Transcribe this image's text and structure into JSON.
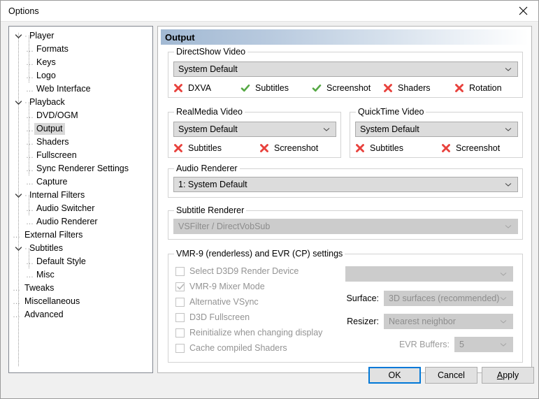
{
  "window": {
    "title": "Options",
    "close_icon": "close-icon"
  },
  "tree": {
    "items": [
      {
        "label": "Player",
        "level": 0,
        "expander": "chevron-down-icon",
        "selected": false
      },
      {
        "label": "Formats",
        "level": 1,
        "expander": "dash",
        "selected": false
      },
      {
        "label": "Keys",
        "level": 1,
        "expander": "dash",
        "selected": false
      },
      {
        "label": "Logo",
        "level": 1,
        "expander": "dash",
        "selected": false
      },
      {
        "label": "Web Interface",
        "level": 1,
        "expander": "dash",
        "selected": false
      },
      {
        "label": "Playback",
        "level": 0,
        "expander": "chevron-down-icon",
        "selected": false
      },
      {
        "label": "DVD/OGM",
        "level": 1,
        "expander": "dash",
        "selected": false
      },
      {
        "label": "Output",
        "level": 1,
        "expander": "dash",
        "selected": true
      },
      {
        "label": "Shaders",
        "level": 1,
        "expander": "dash",
        "selected": false
      },
      {
        "label": "Fullscreen",
        "level": 1,
        "expander": "dash",
        "selected": false
      },
      {
        "label": "Sync Renderer Settings",
        "level": 1,
        "expander": "dash",
        "selected": false
      },
      {
        "label": "Capture",
        "level": 1,
        "expander": "dash",
        "selected": false
      },
      {
        "label": "Internal Filters",
        "level": 0,
        "expander": "chevron-down-icon",
        "selected": false
      },
      {
        "label": "Audio Switcher",
        "level": 1,
        "expander": "dash",
        "selected": false
      },
      {
        "label": "Audio Renderer",
        "level": 1,
        "expander": "dash",
        "selected": false
      },
      {
        "label": "External Filters",
        "level": 0,
        "expander": "dash",
        "selected": false
      },
      {
        "label": "Subtitles",
        "level": 0,
        "expander": "chevron-down-icon",
        "selected": false
      },
      {
        "label": "Default Style",
        "level": 1,
        "expander": "dash",
        "selected": false
      },
      {
        "label": "Misc",
        "level": 1,
        "expander": "dash",
        "selected": false
      },
      {
        "label": "Tweaks",
        "level": 0,
        "expander": "dash",
        "selected": false
      },
      {
        "label": "Miscellaneous",
        "level": 0,
        "expander": "dash",
        "selected": false
      },
      {
        "label": "Advanced",
        "level": 0,
        "expander": "dash",
        "selected": false
      }
    ]
  },
  "page": {
    "header": "Output"
  },
  "directshow": {
    "group_title": "DirectShow Video",
    "combo_value": "System Default",
    "features": [
      {
        "label": "DXVA",
        "state": "no",
        "icon": "red-x-icon"
      },
      {
        "label": "Subtitles",
        "state": "yes",
        "icon": "green-check-icon"
      },
      {
        "label": "Screenshot",
        "state": "yes",
        "icon": "green-check-icon"
      },
      {
        "label": "Shaders",
        "state": "no",
        "icon": "red-x-icon"
      },
      {
        "label": "Rotation",
        "state": "no",
        "icon": "red-x-icon"
      }
    ]
  },
  "realmedia": {
    "group_title": "RealMedia Video",
    "combo_value": "System Default",
    "features": [
      {
        "label": "Subtitles",
        "state": "no",
        "icon": "red-x-icon"
      },
      {
        "label": "Screenshot",
        "state": "no",
        "icon": "red-x-icon"
      }
    ]
  },
  "quicktime": {
    "group_title": "QuickTime Video",
    "combo_value": "System Default",
    "features": [
      {
        "label": "Subtitles",
        "state": "no",
        "icon": "red-x-icon"
      },
      {
        "label": "Screenshot",
        "state": "no",
        "icon": "red-x-icon"
      }
    ]
  },
  "audio_renderer": {
    "group_title": "Audio Renderer",
    "combo_value": "1: System Default"
  },
  "subtitle_renderer": {
    "group_title": "Subtitle Renderer",
    "combo_value": "VSFilter / DirectVobSub",
    "disabled": true
  },
  "vmr9": {
    "group_title": "VMR-9 (renderless) and EVR (CP) settings",
    "checkboxes": [
      {
        "label": "Select D3D9 Render Device",
        "checked": false,
        "disabled": true
      },
      {
        "label": "VMR-9 Mixer Mode",
        "checked": true,
        "disabled": true
      },
      {
        "label": "Alternative VSync",
        "checked": false,
        "disabled": true
      },
      {
        "label": "D3D Fullscreen",
        "checked": false,
        "disabled": true
      },
      {
        "label": "Reinitialize when changing display",
        "checked": false,
        "disabled": true
      },
      {
        "label": "Cache compiled Shaders",
        "checked": false,
        "disabled": true
      }
    ],
    "device_combo_value": "",
    "surface_label": "Surface:",
    "surface_value": "3D surfaces (recommended)",
    "resizer_label": "Resizer:",
    "resizer_value": "Nearest neighbor",
    "evr_buffers_label": "EVR Buffers:",
    "evr_buffers_value": "5"
  },
  "footer": {
    "ok": "OK",
    "cancel": "Cancel",
    "apply_accel": "A",
    "apply_rest": "pply"
  },
  "colors": {
    "accent": "#0078d7",
    "header_gradient_start": "#a2b9d3",
    "ok_no": "#e8413c",
    "ok_yes": "#55a844",
    "selected_row": "#d8d8d8"
  }
}
